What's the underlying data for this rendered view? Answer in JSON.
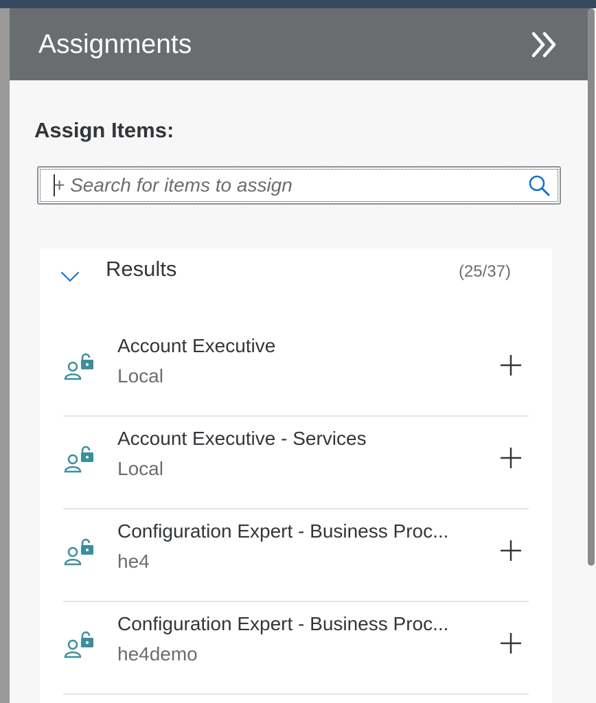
{
  "header": {
    "title": "Assignments",
    "collapse_icon": "double-chevron-right-icon"
  },
  "assign": {
    "label": "Assign Items:",
    "search_placeholder": "+ Search for items to assign",
    "search_icon": "search-icon"
  },
  "results": {
    "title": "Results",
    "count": "(25/37)",
    "expand_icon": "chevron-down-icon",
    "items": [
      {
        "title": "Account Executive",
        "subtitle": "Local"
      },
      {
        "title": "Account Executive - Services",
        "subtitle": "Local"
      },
      {
        "title": "Configuration Expert - Business Proc...",
        "subtitle": "he4"
      },
      {
        "title": "Configuration Expert - Business Proc...",
        "subtitle": "he4demo"
      }
    ]
  },
  "colors": {
    "header_bg": "#6a6d70",
    "top_bar": "#354a5f",
    "icon_teal": "#3b8f9c",
    "chevron_blue": "#0a6ed1"
  }
}
